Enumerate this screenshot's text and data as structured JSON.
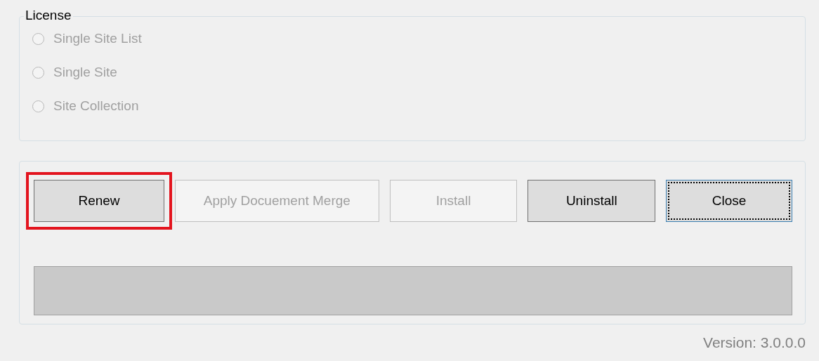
{
  "license_group": {
    "title": "License",
    "options": [
      {
        "label": "Single Site List",
        "selected": false,
        "disabled": true
      },
      {
        "label": "Single Site",
        "selected": false,
        "disabled": true
      },
      {
        "label": "Site Collection",
        "selected": false,
        "disabled": true
      }
    ]
  },
  "buttons": [
    {
      "label": "Renew",
      "disabled": false,
      "focused": false,
      "highlighted": true
    },
    {
      "label": "Apply Docuement Merge",
      "disabled": true,
      "focused": false,
      "highlighted": false
    },
    {
      "label": "Install",
      "disabled": true,
      "focused": false,
      "highlighted": false
    },
    {
      "label": "Uninstall",
      "disabled": false,
      "focused": false,
      "highlighted": false
    },
    {
      "label": "Close",
      "disabled": false,
      "focused": true,
      "highlighted": false
    }
  ],
  "version": "Version: 3.0.0.0"
}
